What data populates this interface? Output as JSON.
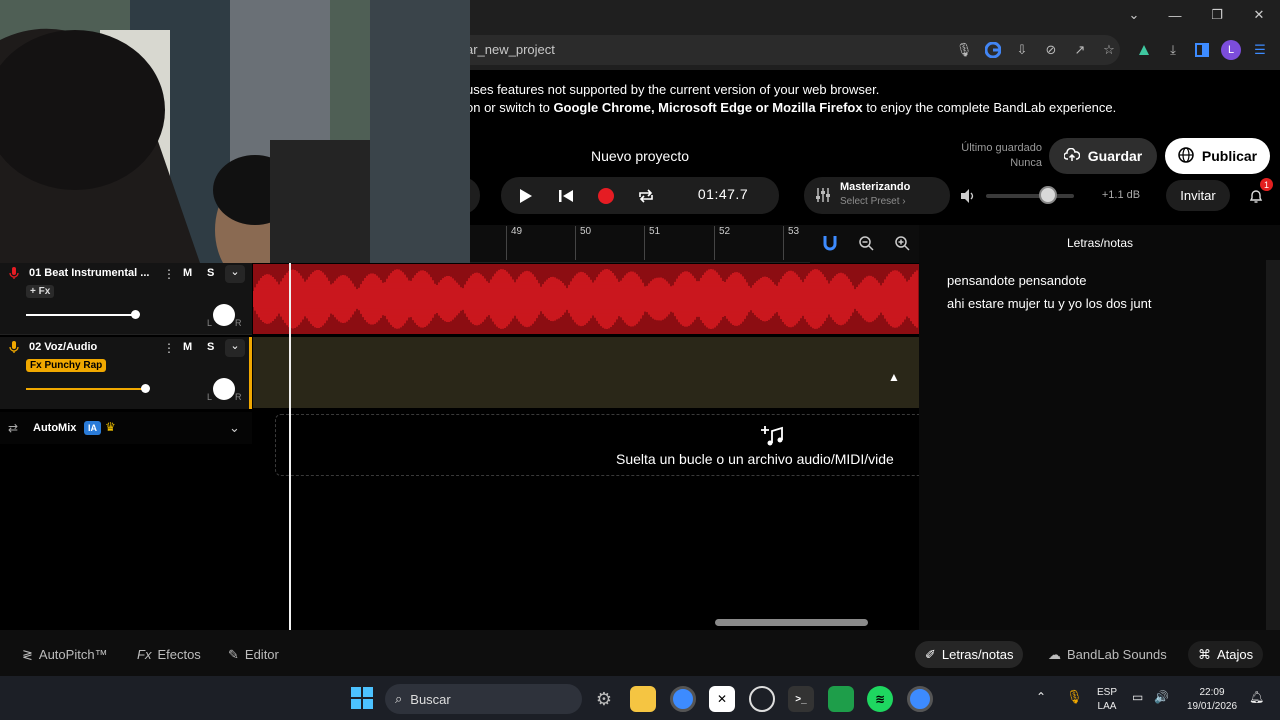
{
  "browser": {
    "url": "ar_new_project",
    "warning_line1": "uses features not supported by the current version of your web browser.",
    "warning_line2_prefix": "on or switch to ",
    "warning_browsers": "Google Chrome, Microsoft Edge or Mozilla Firefox",
    "warning_line2_suffix": " to enjoy the complete BandLab experience.",
    "profile_initial": "L",
    "window_buttons": [
      "chevron-down",
      "minimize",
      "restore",
      "close"
    ]
  },
  "header": {
    "project_title": "Nuevo proyecto",
    "last_saved_label": "Último guardado",
    "last_saved_value": "Nunca",
    "save_label": "Guardar",
    "publish_label": "Publicar",
    "time": "01:47.7",
    "master_title": "Masterizando",
    "master_preset": "Select Preset",
    "db_value": "+1.1 dB",
    "invite_label": "Invitar",
    "notif_count": "1",
    "volume_level": 0.7
  },
  "ruler": {
    "ticks": [
      "49",
      "50",
      "51",
      "52",
      "53"
    ]
  },
  "tracks": [
    {
      "name": "01  Beat Instrumental ...",
      "mute": "M",
      "solo": "S",
      "fx": "+ Fx",
      "volume": 0.8,
      "left": "L",
      "right": "R",
      "color": "#e51c23"
    },
    {
      "name": "02  Voz/Audio",
      "mute": "M",
      "solo": "S",
      "fx": "Fx Punchy Rap",
      "volume": 0.8,
      "left": "L",
      "right": "R",
      "color": "#f0a800"
    }
  ],
  "automix": {
    "label": "AutoMix",
    "badge": "IA"
  },
  "dropzone": {
    "text": "Suelta un bucle o un archivo audio/MIDI/vide"
  },
  "lyrics": {
    "title": "Letras/notas",
    "lines": [
      "pensandote pensandote",
      "ahi estare mujer  tu y yo los dos junt"
    ]
  },
  "bottom_toolbar": {
    "autopitch": "AutoPitch™",
    "effects_prefix": "Fx",
    "effects": "Efectos",
    "editor": "Editor",
    "lyrics_notes": "Letras/notas",
    "bandlab_sounds": "BandLab Sounds",
    "shortcuts": "Atajos"
  },
  "taskbar": {
    "search": "Buscar",
    "lang_top": "ESP",
    "lang_bottom": "LAA",
    "time": "22:09",
    "date": "19/01/2026"
  },
  "colors": {
    "accent_red": "#e51c23",
    "accent_yellow": "#f0a800",
    "automix_badge": "#2a7bd8"
  }
}
